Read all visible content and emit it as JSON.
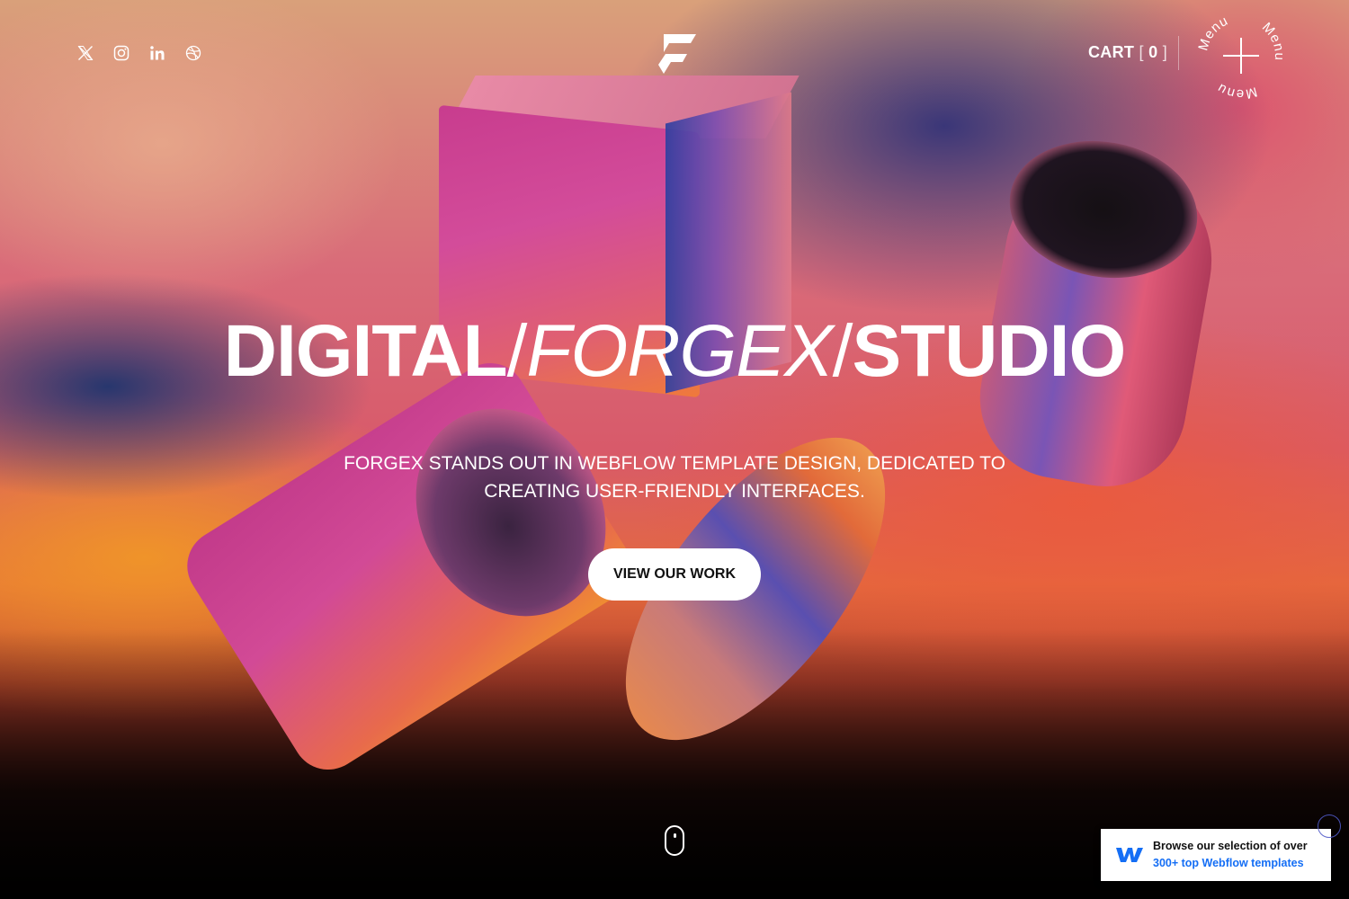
{
  "header": {
    "social_links": [
      {
        "name": "x-icon"
      },
      {
        "name": "instagram-icon"
      },
      {
        "name": "linkedin-icon"
      },
      {
        "name": "dribbble-icon"
      }
    ],
    "cart_label": "CART",
    "cart_open_bracket": "[",
    "cart_count": "0",
    "cart_close_bracket": "]",
    "menu_label": "Menu"
  },
  "hero": {
    "headline_part1": "DIGITAL",
    "headline_slash1": "/",
    "headline_part2": "FORGEX",
    "headline_slash2": "/",
    "headline_part3": "STUDIO",
    "subtext": "FORGEX STANDS OUT IN WEBFLOW TEMPLATE DESIGN, DEDICATED TO CREATING USER-FRIENDLY INTERFACES.",
    "cta_label": "VIEW OUR WORK"
  },
  "badge": {
    "line1": "Browse our selection of over",
    "line2": "300+ top Webflow templates",
    "brand_color": "#146ef5"
  }
}
